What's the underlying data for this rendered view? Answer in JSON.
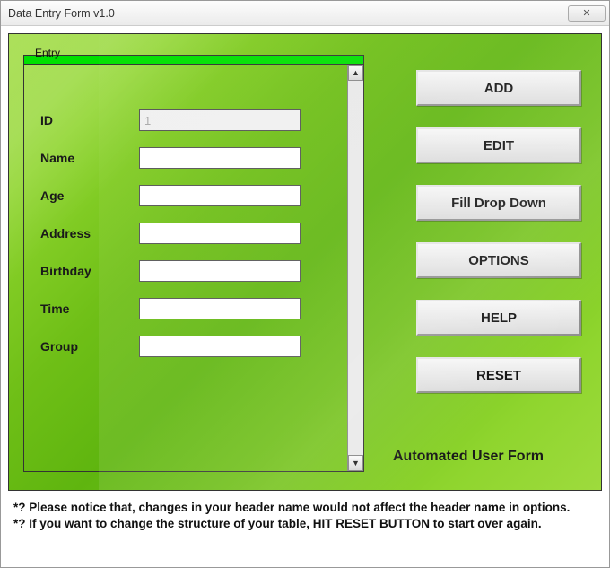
{
  "window": {
    "title": "Data Entry Form v1.0",
    "close_glyph": "✕"
  },
  "entry": {
    "legend": "Entry",
    "fields": {
      "id": {
        "label": "ID",
        "value": "1"
      },
      "name": {
        "label": "Name",
        "value": ""
      },
      "age": {
        "label": "Age",
        "value": ""
      },
      "address": {
        "label": "Address",
        "value": ""
      },
      "birthday": {
        "label": "Birthday",
        "value": ""
      },
      "time": {
        "label": "Time",
        "value": ""
      },
      "group": {
        "label": "Group",
        "value": ""
      }
    }
  },
  "buttons": {
    "add": "ADD",
    "edit": "EDIT",
    "fill": "Fill Drop Down",
    "options": "OPTIONS",
    "help": "HELP",
    "reset": "RESET"
  },
  "footer_label": "Automated User Form",
  "notes": {
    "line1": "*? Please notice that, changes in your header name would not affect the header name in options.",
    "line2": "*? If you want to change the structure of your table, HIT RESET BUTTON to start over again."
  },
  "scroll": {
    "up": "▲",
    "down": "▼"
  }
}
